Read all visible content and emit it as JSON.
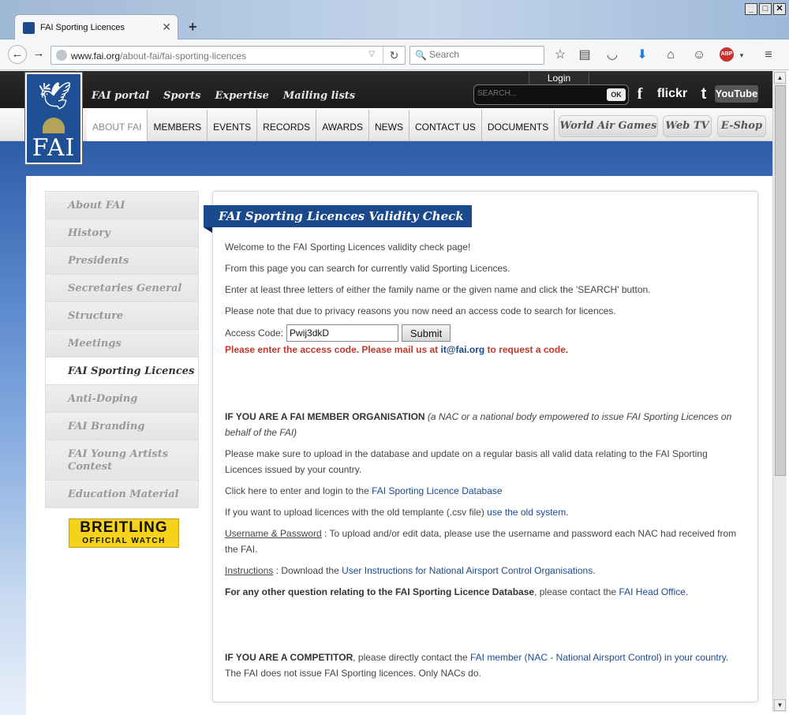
{
  "browser": {
    "tab_title": "FAI Sporting Licences",
    "new_tab_label": "+",
    "url_domain": "www.fai.org",
    "url_path": "/about-fai/fai-sporting-licences",
    "search_placeholder": "Search",
    "abp_label": "ABP"
  },
  "header": {
    "logo_text": "FAI",
    "top_nav": [
      "FAI portal",
      "Sports",
      "Expertise",
      "Mailing lists"
    ],
    "login_label": "Login",
    "search_placeholder": "SEARCH...",
    "search_ok": "OK",
    "social": [
      "f",
      "flickr",
      "t",
      "YouTube"
    ],
    "main_nav": [
      "ABOUT FAI",
      "MEMBERS",
      "EVENTS",
      "RECORDS",
      "AWARDS",
      "NEWS",
      "CONTACT US",
      "DOCUMENTS"
    ],
    "pills": [
      "World Air Games",
      "Web TV",
      "E-Shop"
    ]
  },
  "sidebar": {
    "items": [
      "About FAI",
      "History",
      "Presidents",
      "Secretaries General",
      "Structure",
      "Meetings",
      "FAI Sporting Licences",
      "Anti-Doping",
      "FAI Branding",
      "FAI Young Artists Contest",
      "Education Material"
    ],
    "active_index": 6,
    "sponsor_line1": "BREITLING",
    "sponsor_line2": "OFFICIAL WATCH"
  },
  "main": {
    "banner_title": "FAI Sporting Licences Validity Check",
    "p1": "Welcome to the FAI Sporting Licences validity check page!",
    "p2": "From this page you can search for currently valid Sporting Licences.",
    "p3": "Enter at least three letters of either the family name or the given name and click the 'SEARCH' button.",
    "p4": "Please note that due to privacy reasons you now need an access code to search for licences.",
    "access_label": "Access Code:",
    "access_value": "Pwij3dkD",
    "submit_label": "Submit",
    "err_pre": "Please enter the access code. Please mail us at ",
    "err_mail": "it@fai.org",
    "err_post": " to request a code.",
    "member_heading": "IF YOU ARE A FAI MEMBER ORGANISATION",
    "member_note": "(a NAC or a national body empowered to issue FAI Sporting Licences on behalf of the FAI)",
    "member_p1": "Please make sure to upload in the database and update on a regular basis all valid data relating to the FAI Sporting Licences issued by your country.",
    "member_p2_pre": "Click here to enter and login to the ",
    "member_p2_link": "FAI Sporting Licence Database",
    "member_p3_pre": "If you want to upload licences with the old templante (.csv file) ",
    "member_p3_link": "use the old system",
    "member_p3_post": ".",
    "userpass_label": "Username & Password",
    "userpass_text": " : To upload and/or edit data, please use the username and password each NAC had received from the FAI.",
    "instr_label": "Instructions",
    "instr_pre": " : Download the ",
    "instr_link": "User Instructions for National Airsport Control Organisations",
    "instr_post": ".",
    "other_bold": "For any other question relating to the FAI Sporting Licence Database",
    "other_pre": ", please contact the ",
    "other_link": "FAI Head Office",
    "other_post": ".",
    "comp_heading": "IF YOU ARE A COMPETITOR",
    "comp_pre": ", please directly contact the ",
    "comp_link": "FAI member (NAC - National Airsport Control) in your country",
    "comp_post": ". The FAI does not issue FAI Sporting licences. Only NACs do."
  },
  "colors": {
    "brand_blue": "#1b4a8c",
    "error_red": "#c0392b"
  }
}
